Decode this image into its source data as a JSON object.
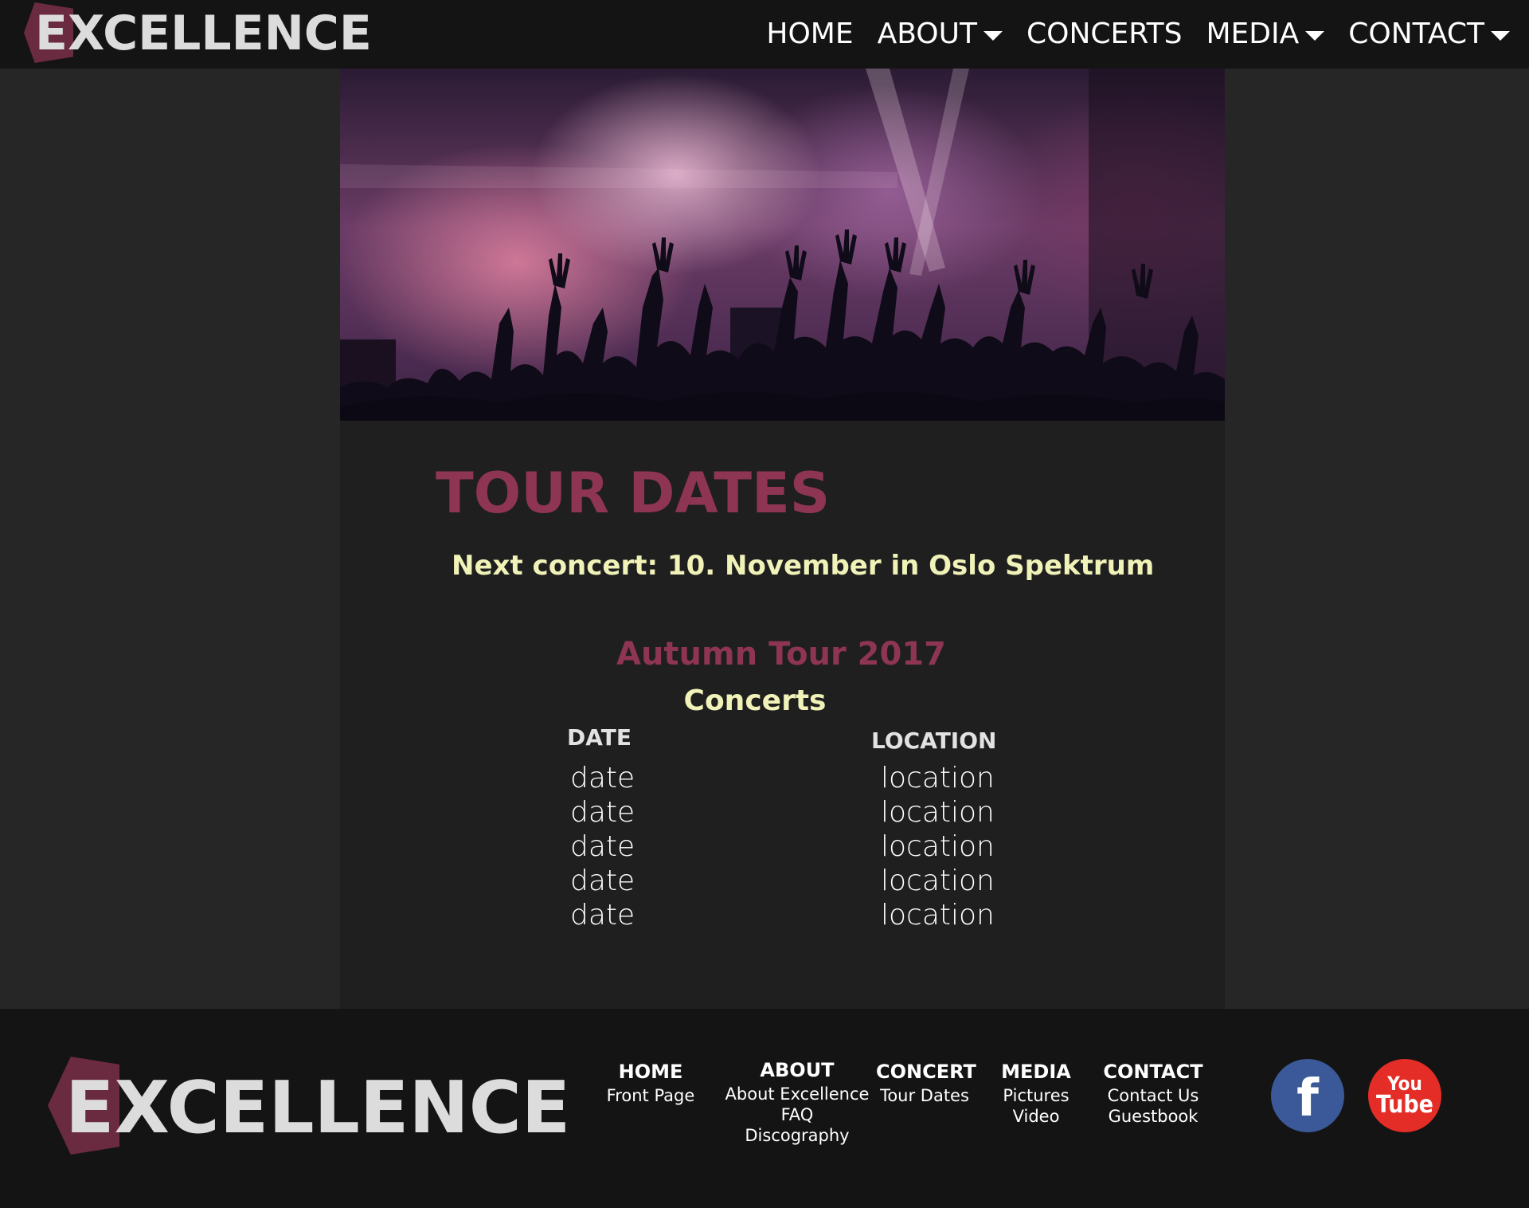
{
  "brand": {
    "name": "EXCELLENCE"
  },
  "nav": {
    "items": [
      {
        "label": "HOME",
        "dropdown": false
      },
      {
        "label": "ABOUT",
        "dropdown": true
      },
      {
        "label": "CONCERTS",
        "dropdown": false
      },
      {
        "label": "MEDIA",
        "dropdown": true
      },
      {
        "label": "CONTACT",
        "dropdown": true
      }
    ]
  },
  "main": {
    "title": "TOUR DATES",
    "next_concert": "Next concert: 10. November in Oslo Spektrum",
    "tour_title": "Autumn Tour 2017",
    "tour_subtitle": "Concerts",
    "table": {
      "headers": [
        "DATE",
        "LOCATION"
      ],
      "rows": [
        [
          "date",
          "location"
        ],
        [
          "date",
          "location"
        ],
        [
          "date",
          "location"
        ],
        [
          "date",
          "location"
        ],
        [
          "date",
          "location"
        ]
      ]
    }
  },
  "footer": {
    "logo": "EXCELLENCE",
    "columns": [
      {
        "heading": "HOME",
        "links": [
          "Front Page"
        ]
      },
      {
        "heading": "ABOUT",
        "links": [
          "About Excellence",
          "FAQ",
          "Discography"
        ]
      },
      {
        "heading": "CONCERT",
        "links": [
          "Tour Dates"
        ]
      },
      {
        "heading": "MEDIA",
        "links": [
          "Pictures",
          "Video"
        ]
      },
      {
        "heading": "CONTACT",
        "links": [
          "Contact Us",
          "Guestbook"
        ]
      }
    ],
    "social": [
      {
        "icon": "facebook-icon",
        "label": "f"
      },
      {
        "icon": "youtube-icon",
        "label_top": "You",
        "label_bottom": "Tube"
      }
    ]
  },
  "colors": {
    "accent": "#8e3553",
    "highlight": "#f0f2b8",
    "background": "#212121",
    "bar": "#141414"
  }
}
